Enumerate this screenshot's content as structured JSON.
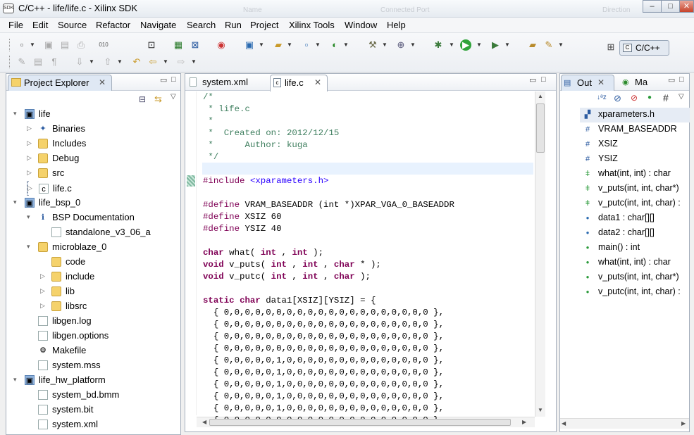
{
  "window": {
    "title": "C/C++ - life/life.c - Xilinx SDK",
    "app_icon": "SDK",
    "bg_tabs": [
      "Name",
      "Connected Port",
      "Direction"
    ]
  },
  "window_controls": {
    "minimize": "–",
    "maximize": "□",
    "close": "✕"
  },
  "menu": [
    "File",
    "Edit",
    "Source",
    "Refactor",
    "Navigate",
    "Search",
    "Run",
    "Project",
    "Xilinx Tools",
    "Window",
    "Help"
  ],
  "perspective": {
    "label": "C/C++"
  },
  "explorer": {
    "title": "Project Explorer",
    "items": [
      {
        "label": "life",
        "icon": "project-icon"
      },
      {
        "label": "Binaries",
        "icon": "binaries-icon"
      },
      {
        "label": "Includes",
        "icon": "includes-icon"
      },
      {
        "label": "Debug",
        "icon": "folder-icon"
      },
      {
        "label": "src",
        "icon": "folder-icon"
      },
      {
        "label": "life.c",
        "icon": "c-file-icon"
      },
      {
        "label": "life_bsp_0",
        "icon": "project-icon"
      },
      {
        "label": "BSP Documentation",
        "icon": "info-icon"
      },
      {
        "label": "standalone_v3_06_a",
        "icon": "file-icon"
      },
      {
        "label": "microblaze_0",
        "icon": "folder-icon"
      },
      {
        "label": "code",
        "icon": "folder-icon"
      },
      {
        "label": "include",
        "icon": "folder-icon"
      },
      {
        "label": "lib",
        "icon": "folder-icon"
      },
      {
        "label": "libsrc",
        "icon": "folder-icon"
      },
      {
        "label": "libgen.log",
        "icon": "file-icon"
      },
      {
        "label": "libgen.options",
        "icon": "file-icon"
      },
      {
        "label": "Makefile",
        "icon": "makefile-icon"
      },
      {
        "label": "system.mss",
        "icon": "file-icon"
      },
      {
        "label": "life_hw_platform",
        "icon": "project-icon"
      },
      {
        "label": "system_bd.bmm",
        "icon": "file-icon"
      },
      {
        "label": "system.bit",
        "icon": "file-icon"
      },
      {
        "label": "system.xml",
        "icon": "file-icon"
      }
    ]
  },
  "editor": {
    "tabs": [
      "system.xml",
      "life.c"
    ],
    "active_tab": "life.c",
    "lines": [
      "/*",
      " * life.c",
      " *",
      " *  Created on: 2012/12/15",
      " *      Author: kuga",
      " */",
      "",
      "#include <xparameters.h>",
      "",
      "#define VRAM_BASEADDR (int *)XPAR_VGA_0_BASEADDR",
      "#define XSIZ 60",
      "#define YSIZ 40",
      "",
      "char what( int , int );",
      "void v_puts( int , int , char * );",
      "void v_putc( int , int , char );",
      "",
      "static char data1[XSIZ][YSIZ] = {",
      "  { 0,0,0,0,0,0,0,0,0,0,0,0,0,0,0,0,0,0,0,0 },",
      "  { 0,0,0,0,0,0,0,0,0,0,0,0,0,0,0,0,0,0,0,0 },",
      "  { 0,0,0,0,0,0,0,0,0,0,0,0,0,0,0,0,0,0,0,0 },",
      "  { 0,0,0,0,0,0,0,0,0,0,0,0,0,0,0,0,0,0,0,0 },",
      "  { 0,0,0,0,0,1,0,0,0,0,0,0,0,0,0,0,0,0,0,0 },",
      "  { 0,0,0,0,0,1,0,0,0,0,0,0,0,0,0,0,0,0,0,0 },",
      "  { 0,0,0,0,0,1,0,0,0,0,0,0,0,0,0,0,0,0,0,0 },",
      "  { 0,0,0,0,0,1,0,0,0,0,0,0,0,0,0,0,0,0,0,0 },",
      "  { 0,0,0,0,0,1,0,0,0,0,0,0,0,0,0,0,0,0,0,0 },",
      "  { 0,0,0,0,0,0,0,0,0,0,0,0,0,0,0,0,0,0,0,0 }"
    ]
  },
  "outline": {
    "tabs": [
      "Out",
      "Ma"
    ],
    "items": [
      {
        "label": "xparameters.h",
        "icon": "include-icon"
      },
      {
        "label": "VRAM_BASEADDR",
        "icon": "macro-icon"
      },
      {
        "label": "XSIZ",
        "icon": "macro-icon"
      },
      {
        "label": "YSIZ",
        "icon": "macro-icon"
      },
      {
        "label": "what(int, int) : char",
        "icon": "function-decl-icon"
      },
      {
        "label": "v_puts(int, int, char*)",
        "icon": "function-decl-icon"
      },
      {
        "label": "v_putc(int, int, char) :",
        "icon": "function-decl-icon"
      },
      {
        "label": "data1 : char[][]",
        "icon": "static-variable-icon"
      },
      {
        "label": "data2 : char[][]",
        "icon": "static-variable-icon"
      },
      {
        "label": "main() : int",
        "icon": "function-icon"
      },
      {
        "label": "what(int, int) : char",
        "icon": "function-icon"
      },
      {
        "label": "v_puts(int, int, char*)",
        "icon": "function-icon"
      },
      {
        "label": "v_putc(int, int, char) :",
        "icon": "function-icon"
      }
    ]
  }
}
